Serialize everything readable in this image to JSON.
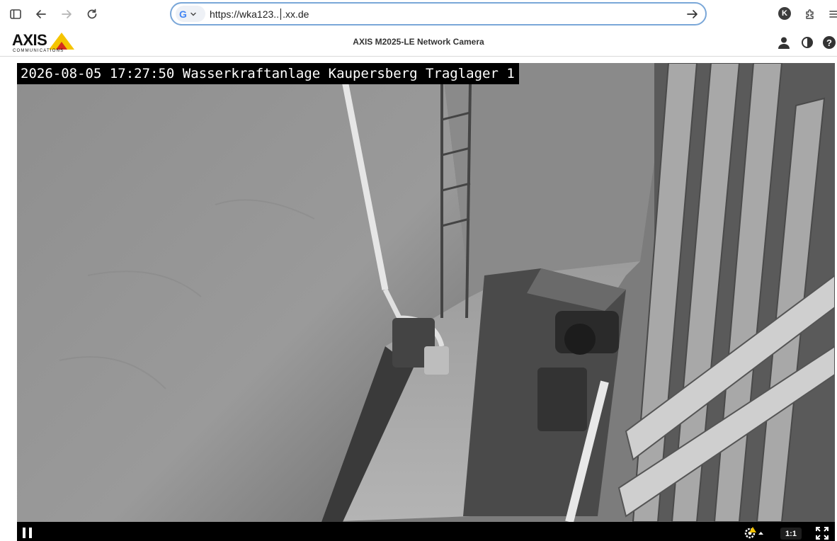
{
  "browser": {
    "url_prefix": "https://wka123..",
    "url_suffix": ".xx.de",
    "search_engine_letter": "G",
    "profile_initial": "K"
  },
  "header": {
    "brand": "AXIS",
    "brand_sub": "COMMUNICATIONS",
    "title": "AXIS M2025-LE Network Camera"
  },
  "video": {
    "overlay_text": "2026-08-05 17:27:50 Wasserkraftanlage Kaupersberg Traglager 1",
    "aspect_label": "1:1",
    "state": "playing"
  },
  "icons": {
    "sidebar": "sidebar-toggle-icon",
    "back": "arrow-left-icon",
    "forward": "arrow-right-icon",
    "reload": "reload-icon",
    "go": "arrow-right-icon",
    "extensions": "puzzle-icon",
    "menu": "menu-icon",
    "user": "user-icon",
    "contrast": "contrast-icon",
    "help": "help-icon",
    "pause": "pause-icon",
    "settings": "gear-warning-icon",
    "fullscreen": "fullscreen-icon"
  },
  "colors": {
    "address_border": "#7aa7d8",
    "axis_yellow": "#f5c400",
    "axis_red": "#d52b1e",
    "video_bg": "#000000"
  }
}
